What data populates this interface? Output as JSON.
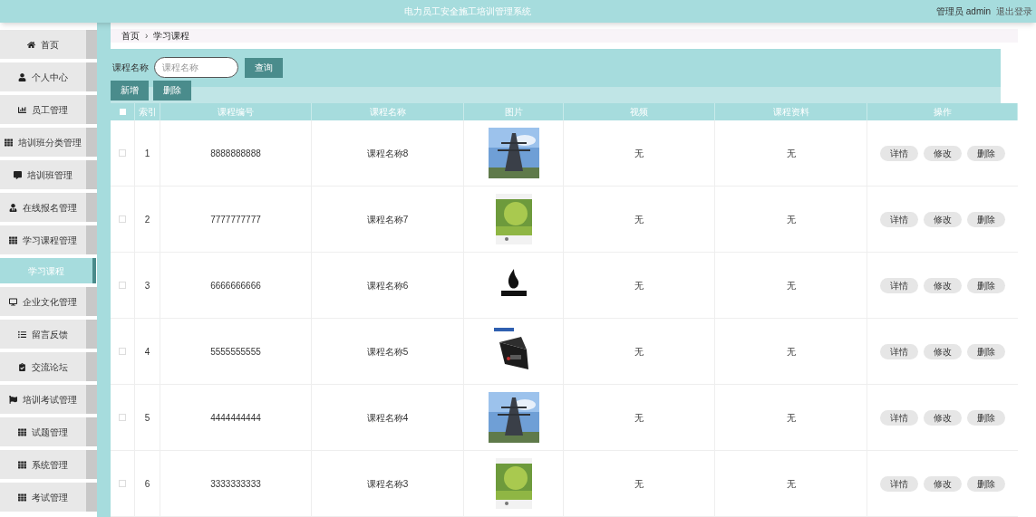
{
  "header": {
    "title": "电力员工安全施工培训管理系统",
    "user": "管理员 admin",
    "logout": "退出登录"
  },
  "sidebar": {
    "items": [
      {
        "label": "首页",
        "kind": "menu",
        "selected": false
      },
      {
        "label": "个人中心",
        "kind": "menu",
        "selected": false
      },
      {
        "label": "员工管理",
        "kind": "menu",
        "selected": false
      },
      {
        "label": "培训班分类管理",
        "kind": "menu",
        "selected": false
      },
      {
        "label": "培训班管理",
        "kind": "menu",
        "selected": false
      },
      {
        "label": "在线报名管理",
        "kind": "menu",
        "selected": false
      },
      {
        "label": "学习课程管理",
        "kind": "menu",
        "selected": false
      },
      {
        "label": "学习课程",
        "kind": "submenu",
        "selected": true
      },
      {
        "label": "企业文化管理",
        "kind": "menu",
        "selected": false
      },
      {
        "label": "留言反馈",
        "kind": "menu",
        "selected": false
      },
      {
        "label": "交流论坛",
        "kind": "menu",
        "selected": false
      },
      {
        "label": "培训考试管理",
        "kind": "menu",
        "selected": false
      },
      {
        "label": "试题管理",
        "kind": "menu",
        "selected": false
      },
      {
        "label": "系统管理",
        "kind": "menu",
        "selected": false
      },
      {
        "label": "考试管理",
        "kind": "menu",
        "selected": false
      }
    ]
  },
  "breadcrumb": {
    "items": [
      "首页",
      "学习课程"
    ],
    "separator": "›"
  },
  "search": {
    "label": "课程名称",
    "placeholder": "课程名称",
    "button": "查询"
  },
  "actions": [
    "新增",
    "删除"
  ],
  "table": {
    "select_all": {
      "checked": false
    },
    "columns": [
      "索引",
      "课程编号",
      "课程名称",
      "图片",
      "视频",
      "课程资料",
      "操作"
    ],
    "rows": [
      {
        "checked": false,
        "index": "1",
        "code": "8888888888",
        "name": "课程名称8",
        "video": "无",
        "material": "无",
        "buttons": [
          "详情",
          "修改",
          "删除"
        ]
      },
      {
        "checked": false,
        "index": "2",
        "code": "7777777777",
        "name": "课程名称7",
        "video": "无",
        "material": "无",
        "buttons": [
          "详情",
          "修改",
          "删除"
        ]
      },
      {
        "checked": false,
        "index": "3",
        "code": "6666666666",
        "name": "课程名称6",
        "video": "无",
        "material": "无",
        "buttons": [
          "详情",
          "修改",
          "删除"
        ]
      },
      {
        "checked": false,
        "index": "4",
        "code": "5555555555",
        "name": "课程名称5",
        "video": "无",
        "material": "无",
        "buttons": [
          "详情",
          "修改",
          "删除"
        ]
      },
      {
        "checked": false,
        "index": "5",
        "code": "4444444444",
        "name": "课程名称4",
        "video": "无",
        "material": "无",
        "buttons": [
          "详情",
          "修改",
          "删除"
        ]
      },
      {
        "checked": false,
        "index": "6",
        "code": "3333333333",
        "name": "课程名称3",
        "video": "无",
        "material": "无",
        "buttons": [
          "详情",
          "修改",
          "删除"
        ]
      }
    ]
  }
}
